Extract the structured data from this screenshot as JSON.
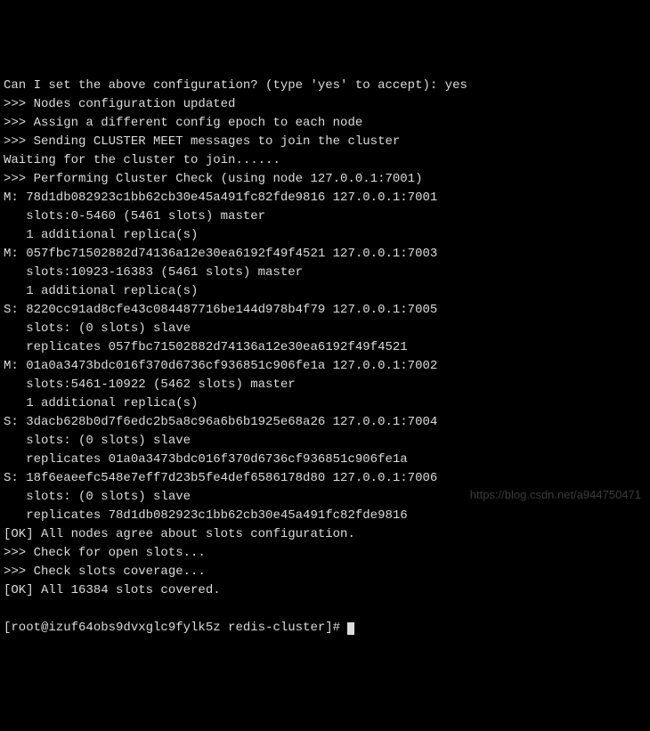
{
  "lines": [
    "Can I set the above configuration? (type 'yes' to accept): yes",
    ">>> Nodes configuration updated",
    ">>> Assign a different config epoch to each node",
    ">>> Sending CLUSTER MEET messages to join the cluster",
    "Waiting for the cluster to join......",
    ">>> Performing Cluster Check (using node 127.0.0.1:7001)",
    "M: 78d1db082923c1bb62cb30e45a491fc82fde9816 127.0.0.1:7001",
    "   slots:0-5460 (5461 slots) master",
    "   1 additional replica(s)",
    "M: 057fbc71502882d74136a12e30ea6192f49f4521 127.0.0.1:7003",
    "   slots:10923-16383 (5461 slots) master",
    "   1 additional replica(s)",
    "S: 8220cc91ad8cfe43c084487716be144d978b4f79 127.0.0.1:7005",
    "   slots: (0 slots) slave",
    "   replicates 057fbc71502882d74136a12e30ea6192f49f4521",
    "M: 01a0a3473bdc016f370d6736cf936851c906fe1a 127.0.0.1:7002",
    "   slots:5461-10922 (5462 slots) master",
    "   1 additional replica(s)",
    "S: 3dacb628b0d7f6edc2b5a8c96a6b6b1925e68a26 127.0.0.1:7004",
    "   slots: (0 slots) slave",
    "   replicates 01a0a3473bdc016f370d6736cf936851c906fe1a",
    "S: 18f6eaeefc548e7eff7d23b5fe4def6586178d80 127.0.0.1:7006",
    "   slots: (0 slots) slave",
    "   replicates 78d1db082923c1bb62cb30e45a491fc82fde9816",
    "[OK] All nodes agree about slots configuration.",
    ">>> Check for open slots...",
    ">>> Check slots coverage...",
    "[OK] All 16384 slots covered."
  ],
  "prompt": "[root@izuf64obs9dvxglc9fylk5z redis-cluster]# ",
  "watermark": "https://blog.csdn.net/a944750471"
}
